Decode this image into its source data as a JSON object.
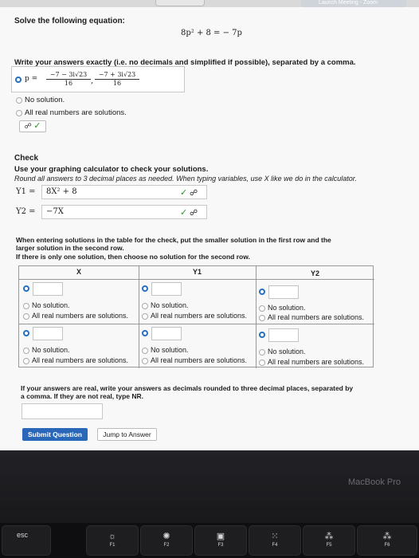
{
  "top_bar": {
    "zoom_label": "Launch Meeting - Zoom"
  },
  "question": {
    "prompt": "Solve the following equation:",
    "equation": "8p² + 8 = − 7p",
    "instructions": "Write your answers exactly (i.e. no decimals and simplified if possible), separated by a comma.",
    "answer_var": "p =",
    "answer1_num": "−7 − 3i√23",
    "answer1_den": "16",
    "answer2_num": "−7 + 3i√23",
    "answer2_den": "16",
    "answer_sep": ",",
    "opt_no_solution": "No solution.",
    "opt_all_real": "All real numbers are solutions."
  },
  "check": {
    "heading": "Check",
    "line1": "Use your graphing calculator to check your solutions.",
    "line2": "Round all answers to 3 decimal places as needed. When typing variables, use X like we do in the calculator.",
    "y1_label": "Y1 =",
    "y1_value": "8X² + 8",
    "y2_label": "Y2 =",
    "y2_value": "−7X"
  },
  "table_section": {
    "instr1": "When entering solutions in the table for the check, put the smaller solution in the first row and the",
    "instr2": "larger solution in the second row.",
    "instr3": "If there is only one solution, then choose no solution for the second row.",
    "col_x": "X",
    "col_y1": "Y1",
    "col_y2": "Y2",
    "no_solution": "No solution.",
    "all_real": "All real numbers are solutions."
  },
  "final": {
    "line1": "If your answers are real, write your answers as decimals rounded to three decimal places, separated by",
    "line2": "a comma. If they are not real, type NR."
  },
  "buttons": {
    "submit": "Submit Question",
    "jump": "Jump to Answer"
  },
  "laptop": {
    "brand": "MacBook Pro",
    "keys": {
      "esc": "esc",
      "f1": "F1",
      "f2": "F2",
      "f3": "F3",
      "f4": "F4",
      "f5": "F5",
      "f6": "F6"
    }
  },
  "colors": {
    "accent": "#2470c2",
    "submit_bg": "#2a67b8",
    "check_green": "#2f8f2f"
  }
}
